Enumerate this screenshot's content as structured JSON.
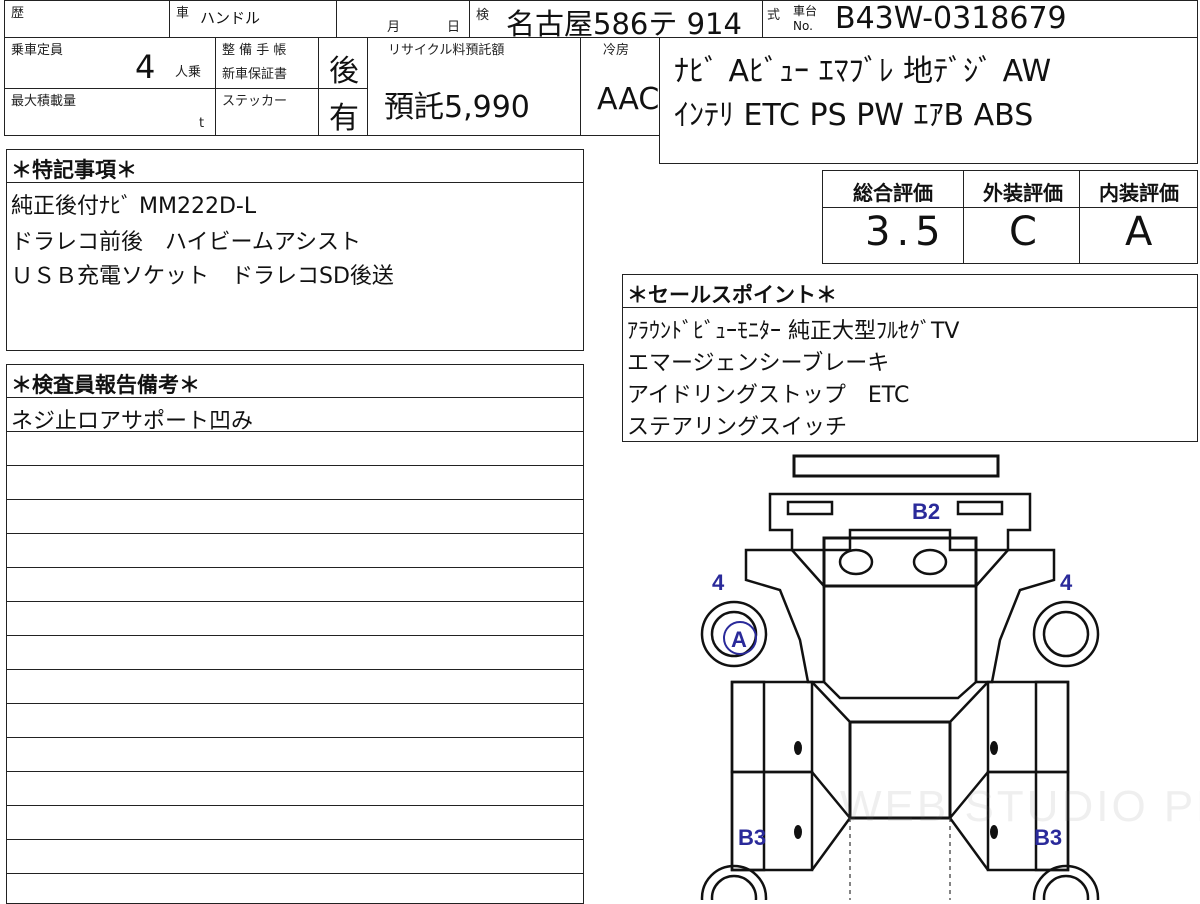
{
  "header": {
    "reki_label": "歴",
    "sha_label": "車",
    "handle_label": "ハンドル",
    "month_label": "月",
    "day_label": "日",
    "ken_label": "検",
    "plate": "名古屋586テ 914",
    "shiki_label": "式",
    "chassis_no_label_top": "車台",
    "chassis_no_label_bottom": "No.",
    "chassis_no": "B43W-0318679"
  },
  "row2": {
    "capacity_label": "乗車定員",
    "capacity_value": "4",
    "capacity_unit": "人乗",
    "seibi_label": "整 備 手 帳",
    "shinsha_label": "新車保証書",
    "seibi_value": "後",
    "recycle_label": "リサイクル料預託額",
    "recycle_value": "預託5,990",
    "aircon_label": "冷房",
    "aircon_value": "AAC",
    "load_label": "最大積載量",
    "load_unit": "t",
    "sticker_label": "ステッカー",
    "sticker_value": "有"
  },
  "equipment": {
    "line1": "ﾅﾋﾞ Aﾋﾞｭｰ ｴﾏﾌﾞﾚ 地ﾃﾞｼﾞ AW",
    "line2": "ｲﾝﾃﾘ ETC PS PW ｴｱB ABS"
  },
  "special_notes": {
    "title": "＊特記事項＊",
    "lines": [
      "純正後付ﾅﾋﾞ MM222D-L",
      "ドラレコ前後　ハイビームアシスト",
      "ＵＳＢ充電ソケット　ドラレコSD後送"
    ]
  },
  "ratings": {
    "overall_label": "総合評価",
    "exterior_label": "外装評価",
    "interior_label": "内装評価",
    "overall_value": "3.5",
    "exterior_value": "C",
    "interior_value": "A"
  },
  "sales_points": {
    "title": "＊セールスポイント＊",
    "lines": [
      "ｱﾗｳﾝﾄﾞﾋﾞｭｰﾓﾆﾀｰ 純正大型ﾌﾙｾｸﾞTV",
      "エマージェンシーブレーキ",
      "アイドリングストップ　ETC",
      "ステアリングスイッチ"
    ]
  },
  "inspector": {
    "title": "＊検査員報告備考＊",
    "line1": "ネジ止ロアサポート凹み"
  },
  "diagram_marks": {
    "b2": "B2",
    "left_4": "4",
    "right_4": "4",
    "a": "A",
    "b3_left": "B3",
    "b3_right": "B3"
  },
  "watermark": "WEB STUDIO PRO"
}
